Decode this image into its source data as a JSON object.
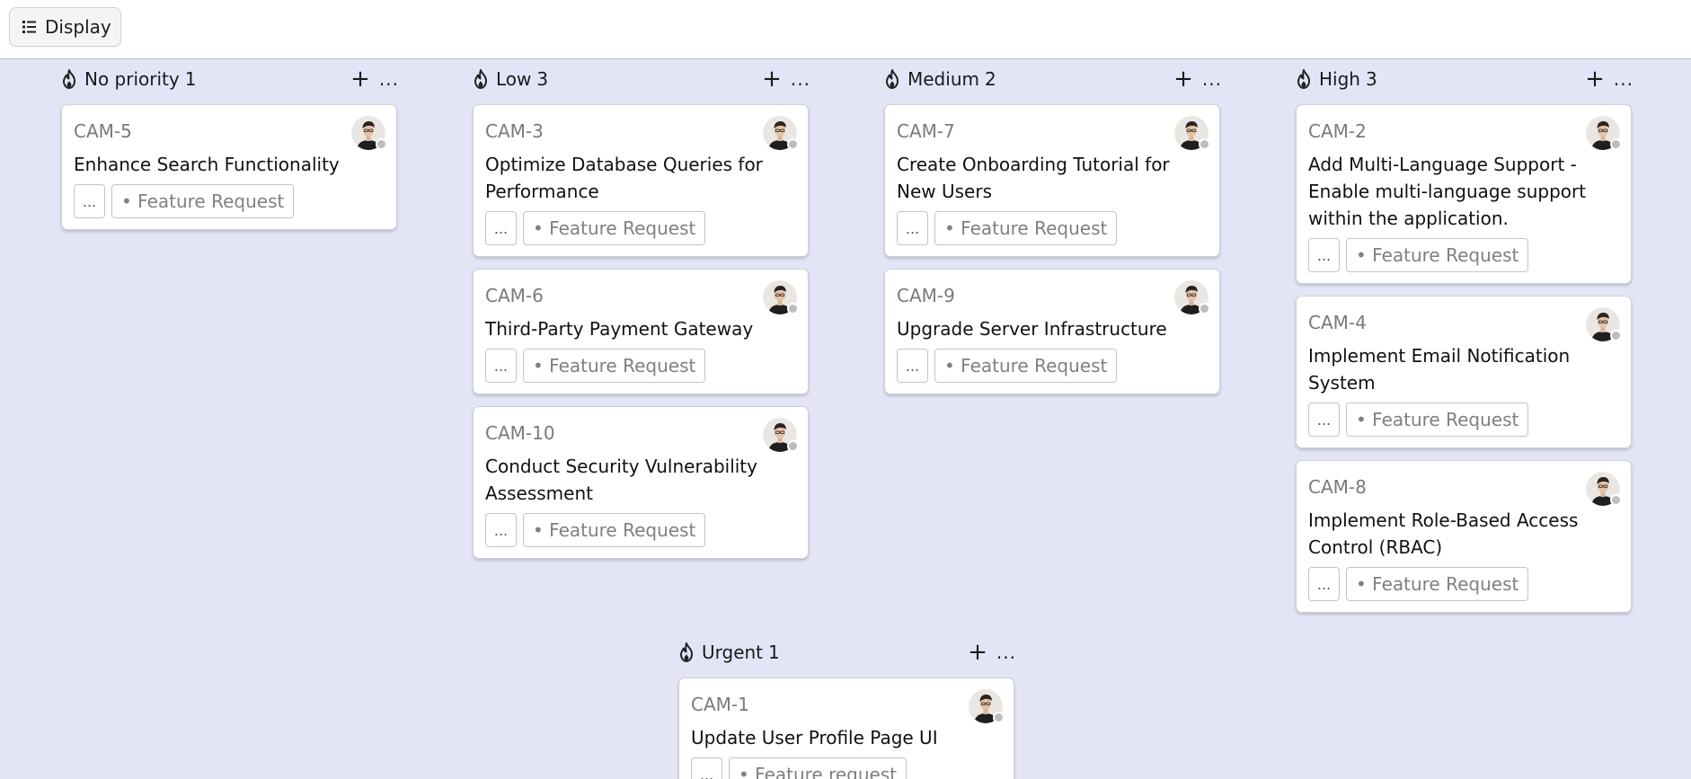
{
  "toolbar": {
    "display_label": "Display"
  },
  "columns": [
    {
      "title": "No priority",
      "count": "1",
      "cards": [
        {
          "id": "CAM-5",
          "title": "Enhance Search Functionality",
          "tag": "• Feature Request"
        }
      ]
    },
    {
      "title": "Low",
      "count": "3",
      "cards": [
        {
          "id": "CAM-3",
          "title": "Optimize Database Queries for Performance",
          "tag": "• Feature Request"
        },
        {
          "id": "CAM-6",
          "title": "Third-Party Payment Gateway",
          "tag": "• Feature Request"
        },
        {
          "id": "CAM-10",
          "title": "Conduct Security Vulnerability Assessment",
          "tag": "• Feature Request"
        }
      ]
    },
    {
      "title": "Medium",
      "count": "2",
      "cards": [
        {
          "id": "CAM-7",
          "title": "Create Onboarding Tutorial for New Users",
          "tag": "• Feature Request"
        },
        {
          "id": "CAM-9",
          "title": "Upgrade Server Infrastructure",
          "tag": "• Feature Request"
        }
      ]
    },
    {
      "title": "High",
      "count": "3",
      "cards": [
        {
          "id": "CAM-2",
          "title": "Add Multi-Language Support - Enable multi-language support within the application.",
          "tag": "• Feature Request"
        },
        {
          "id": "CAM-4",
          "title": "Implement Email Notification System",
          "tag": "• Feature Request"
        },
        {
          "id": "CAM-8",
          "title": "Implement Role-Based Access Control (RBAC)",
          "tag": "• Feature Request"
        }
      ]
    },
    {
      "title": "Urgent",
      "count": "1",
      "cards": [
        {
          "id": "CAM-1",
          "title": "Update User Profile Page UI",
          "tag": "• Feature request"
        }
      ]
    }
  ],
  "labels": {
    "add": "+",
    "more": "...",
    "tag_more": "..."
  },
  "colors": {
    "board_bg": "#e3e5f7",
    "status_dot": "#bdbdbd"
  },
  "icons": {
    "column": "fire-icon",
    "display": "list-icon"
  }
}
